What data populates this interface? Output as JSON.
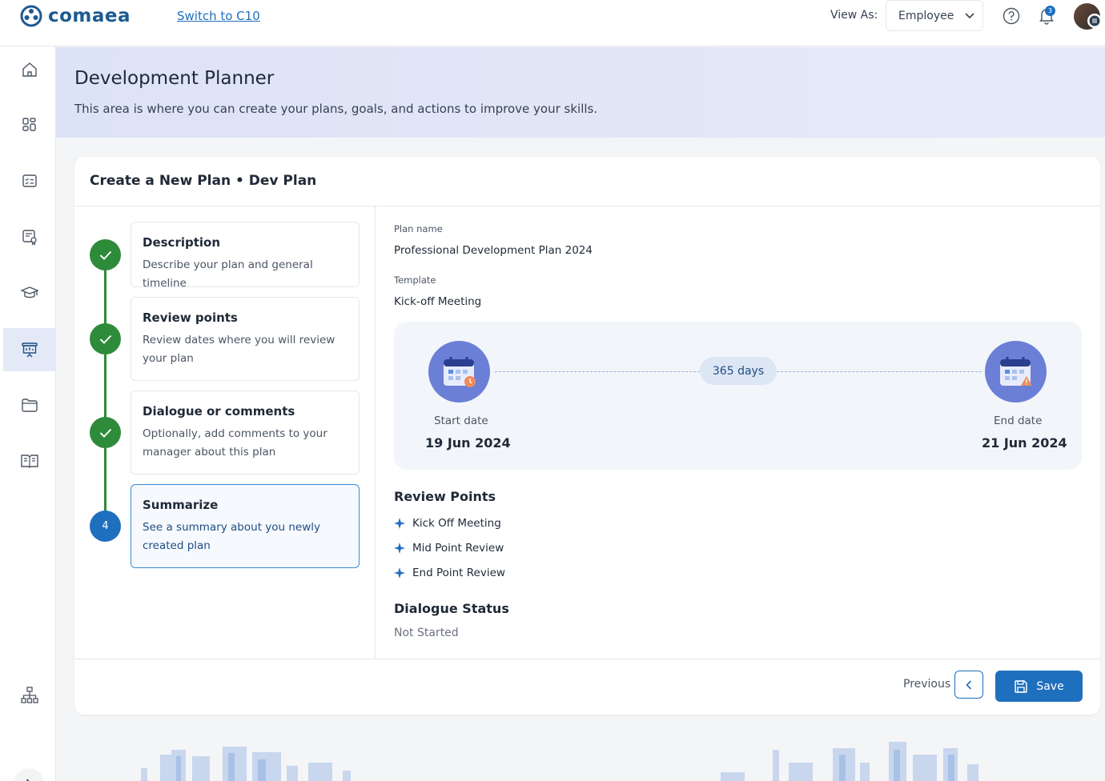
{
  "header": {
    "logo_text": "comaea",
    "switch_link": "Switch to C10",
    "view_as_label": "View As:",
    "view_as_value": "Employee",
    "notification_count": "3"
  },
  "banner": {
    "title": "Development Planner",
    "subtitle": "This area is where you can create your plans, goals, and actions to improve your skills."
  },
  "card": {
    "title": "Create a New Plan • Dev Plan"
  },
  "steps": [
    {
      "title": "Description",
      "desc": "Describe your plan and general timeline",
      "status": "done"
    },
    {
      "title": "Review points",
      "desc": "Review dates where you will review your plan",
      "status": "done"
    },
    {
      "title": "Dialogue or comments",
      "desc": "Optionally, add comments to your manager about this plan",
      "status": "done"
    },
    {
      "title": "Summarize",
      "desc": "See a summary about you newly created plan",
      "status": "current",
      "number": "4"
    }
  ],
  "summary": {
    "plan_name_label": "Plan name",
    "plan_name": "Professional Development Plan 2024",
    "template_label": "Template",
    "template": "Kick-off Meeting",
    "duration": "365 days",
    "start_label": "Start date",
    "start_date": "19 Jun 2024",
    "end_label": "End date",
    "end_date": "21 Jun 2024",
    "review_points_title": "Review Points",
    "review_points": [
      "Kick Off Meeting",
      "Mid Point Review",
      "End Point Review"
    ],
    "dialogue_title": "Dialogue Status",
    "dialogue_status": "Not Started"
  },
  "footer": {
    "previous_label": "Previous",
    "save_label": "Save"
  },
  "colors": {
    "brand": "#1d5a92",
    "accent": "#1f6fbf",
    "done": "#2e8b3a",
    "banner": "#dde3f6"
  }
}
